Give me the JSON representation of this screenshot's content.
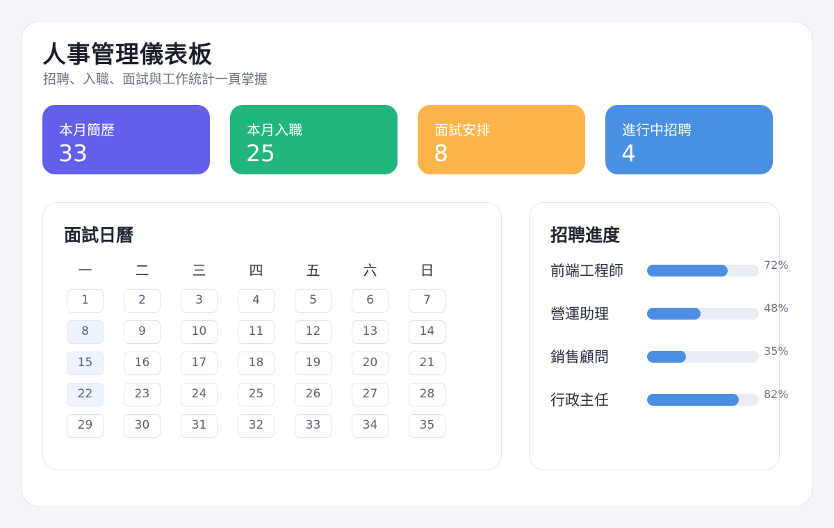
{
  "header": {
    "title": "人事管理儀表板",
    "subtitle": "招聘、入職、面試與工作統計一頁掌握"
  },
  "stats": [
    {
      "label": "本月簡歷",
      "value": "33",
      "color": "#6260ea"
    },
    {
      "label": "本月入職",
      "value": "25",
      "color": "#22b67d"
    },
    {
      "label": "面試安排",
      "value": "8",
      "color": "#fdb54a"
    },
    {
      "label": "進行中招聘",
      "value": "4",
      "color": "#4a90e2"
    }
  ],
  "calendar": {
    "title": "面試日曆",
    "weekdays": [
      "一",
      "二",
      "三",
      "四",
      "五",
      "六",
      "日"
    ],
    "days": [
      "1",
      "2",
      "3",
      "4",
      "5",
      "6",
      "7",
      "8",
      "9",
      "10",
      "11",
      "12",
      "13",
      "14",
      "15",
      "16",
      "17",
      "18",
      "19",
      "20",
      "21",
      "22",
      "23",
      "24",
      "25",
      "26",
      "27",
      "28",
      "29",
      "30",
      "31",
      "32",
      "33",
      "34",
      "35"
    ],
    "highlighted": [
      "8",
      "15",
      "22"
    ]
  },
  "recruitment": {
    "title": "招聘進度",
    "bar_color": "#4a8fe2",
    "jobs": [
      {
        "name": "前端工程師",
        "percent": 72,
        "label": "72%"
      },
      {
        "name": "營運助理",
        "percent": 48,
        "label": "48%"
      },
      {
        "name": "銷售顧問",
        "percent": 35,
        "label": "35%"
      },
      {
        "name": "行政主任",
        "percent": 82,
        "label": "82%"
      }
    ]
  }
}
